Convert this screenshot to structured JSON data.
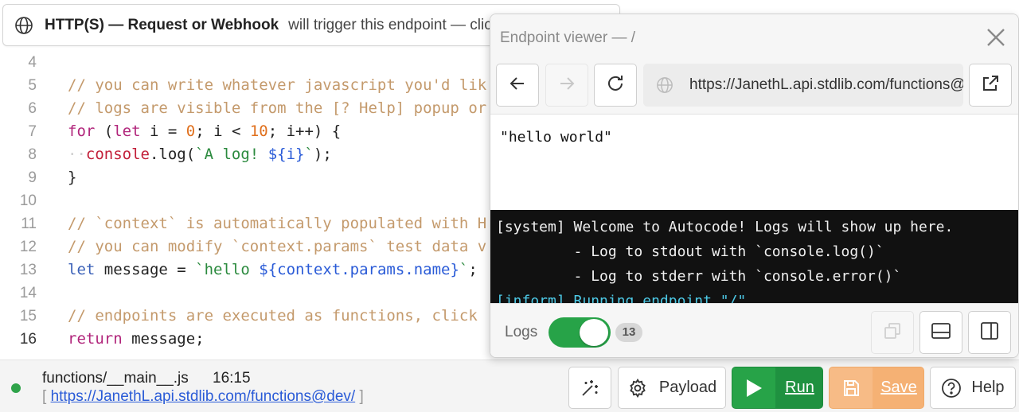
{
  "trigger": {
    "title": "HTTP(S) — Request or Webhook",
    "description": "will trigger this endpoint — click"
  },
  "editor": {
    "active_line": "16",
    "lines": [
      {
        "n": "4",
        "parts": []
      },
      {
        "n": "5",
        "parts": [
          {
            "t": "// you can write whatever javascript you'd lik",
            "c": "c-comment"
          }
        ]
      },
      {
        "n": "6",
        "parts": [
          {
            "t": "// logs are visible from the [? Help] popup or",
            "c": "c-comment"
          }
        ]
      },
      {
        "n": "7",
        "parts": [
          {
            "t": "for",
            "c": "c-kw"
          },
          {
            "t": " (",
            "c": ""
          },
          {
            "t": "let",
            "c": "c-kw"
          },
          {
            "t": " i = ",
            "c": ""
          },
          {
            "t": "0",
            "c": "c-num"
          },
          {
            "t": "; i < ",
            "c": ""
          },
          {
            "t": "10",
            "c": "c-num"
          },
          {
            "t": "; i++) {",
            "c": ""
          }
        ]
      },
      {
        "n": "8",
        "parts": [
          {
            "t": "··",
            "c": "c-dots"
          },
          {
            "t": "console",
            "c": "c-red"
          },
          {
            "t": ".log(",
            "c": ""
          },
          {
            "t": "`A log! ",
            "c": "c-str"
          },
          {
            "t": "${i}",
            "c": "c-interp"
          },
          {
            "t": "`",
            "c": "c-str"
          },
          {
            "t": ");",
            "c": ""
          }
        ]
      },
      {
        "n": "9",
        "parts": [
          {
            "t": "}",
            "c": ""
          }
        ]
      },
      {
        "n": "10",
        "parts": []
      },
      {
        "n": "11",
        "parts": [
          {
            "t": "// `context` is automatically populated with H",
            "c": "c-comment"
          }
        ]
      },
      {
        "n": "12",
        "parts": [
          {
            "t": "// you can modify `context.params` test data v",
            "c": "c-comment"
          }
        ]
      },
      {
        "n": "13",
        "parts": [
          {
            "t": "let",
            "c": "c-kw2"
          },
          {
            "t": " message = ",
            "c": ""
          },
          {
            "t": "`hello ",
            "c": "c-str"
          },
          {
            "t": "${context.params.name}",
            "c": "c-interp"
          },
          {
            "t": "`",
            "c": "c-str"
          },
          {
            "t": ";",
            "c": ""
          }
        ]
      },
      {
        "n": "14",
        "parts": []
      },
      {
        "n": "15",
        "parts": [
          {
            "t": "// endpoints are executed as functions, click",
            "c": "c-comment"
          }
        ]
      },
      {
        "n": "16",
        "parts": [
          {
            "t": "return",
            "c": "c-kw"
          },
          {
            "t": " message;",
            "c": ""
          }
        ]
      }
    ]
  },
  "footer": {
    "file_name": "functions/__main__.js",
    "time": "16:15",
    "url_open": "[",
    "url": "https://JanethL.api.stdlib.com/functions@dev/",
    "url_close": "]",
    "buttons": {
      "payload": "Payload",
      "run": "Run",
      "save": "Save",
      "help": "Help"
    }
  },
  "viewer": {
    "title": "Endpoint viewer — /",
    "url": "https://JanethL.api.stdlib.com/functions@dev/",
    "response": "\"hello world\"",
    "console": [
      {
        "t": "[system] Welcome to Autocode! Logs will show up here.",
        "c": ""
      },
      {
        "t": "         - Log to stdout with `console.log()`",
        "c": ""
      },
      {
        "t": "         - Log to stderr with `console.error()`",
        "c": ""
      },
      {
        "t": "[inform] Running endpoint \"/\"...",
        "c": "con-inform"
      }
    ],
    "logs_label": "Logs",
    "logs_enabled": true,
    "log_count": "13"
  },
  "colors": {
    "run_green": "#27a348",
    "save_orange": "#f7bb86",
    "link_blue": "#2a5bd7",
    "comment": "#c49a6c",
    "console_bg": "#111111"
  }
}
